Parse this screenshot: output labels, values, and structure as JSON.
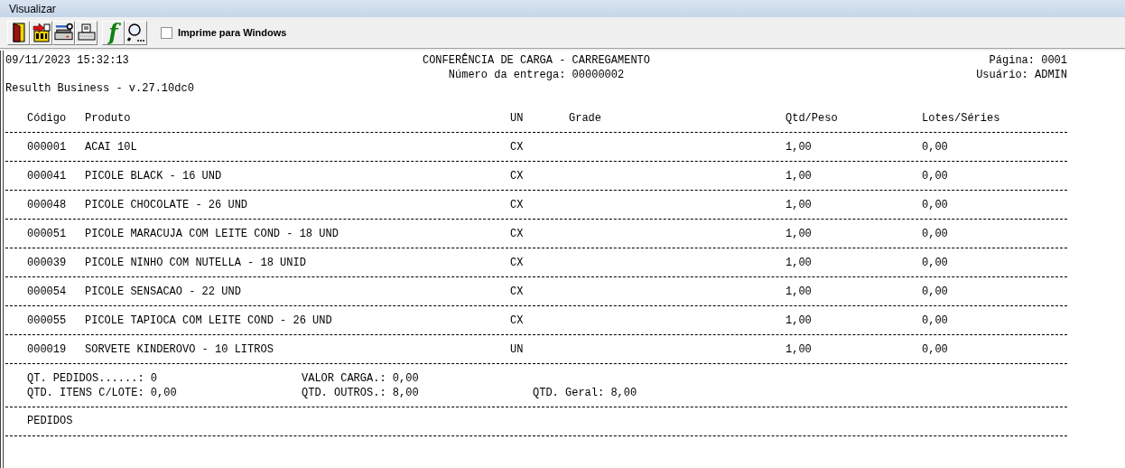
{
  "window": {
    "title": "Visualizar"
  },
  "toolbar": {
    "buttons": [
      {
        "kind": "exit"
      },
      {
        "kind": "export"
      },
      {
        "kind": "printer_setup"
      },
      {
        "kind": "print"
      },
      {
        "kind": "function",
        "label": "f"
      },
      {
        "kind": "zoom"
      }
    ],
    "print_windows": {
      "label": "Imprime para Windows",
      "checked": false
    }
  },
  "report": {
    "datetime": "09/11/2023 15:32:13",
    "title": "CONFERÊNCIA DE CARGA - CARREGAMENTO",
    "delivery": "Número da entrega: 00000002",
    "page": "Página: 0001",
    "user": "Usuário: ADMIN",
    "system": "Resulth Business - v.27.10dc0",
    "columns": [
      "Código",
      "Produto",
      "UN",
      "Grade",
      "Qtd/Peso",
      "Lotes/Séries"
    ],
    "rows": [
      [
        "000001",
        "ACAI 10L",
        "CX",
        "",
        "1,00",
        "0,00"
      ],
      [
        "000041",
        "PICOLE BLACK - 16 UND",
        "CX",
        "",
        "1,00",
        "0,00"
      ],
      [
        "000048",
        "PICOLE CHOCOLATE - 26 UND",
        "CX",
        "",
        "1,00",
        "0,00"
      ],
      [
        "000051",
        "PICOLE MARACUJA COM LEITE COND - 18 UND",
        "CX",
        "",
        "1,00",
        "0,00"
      ],
      [
        "000039",
        "PICOLE NINHO COM NUTELLA - 18 UNID",
        "CX",
        "",
        "1,00",
        "0,00"
      ],
      [
        "000054",
        "PICOLE SENSACAO - 22 UND",
        "CX",
        "",
        "1,00",
        "0,00"
      ],
      [
        "000055",
        "PICOLE TAPIOCA COM LEITE COND - 26 UND",
        "CX",
        "",
        "1,00",
        "0,00"
      ],
      [
        "000019",
        "SORVETE KINDEROVO - 10 LITROS",
        "UN",
        "",
        "1,00",
        "0,00"
      ]
    ],
    "totals": [
      [
        "QT. PEDIDOS......: 0",
        "VALOR CARGA.: 0,00"
      ],
      [
        "QTD. ITENS C/LOTE: 0,00",
        "QTD. OUTROS.: 8,00",
        "QTD. Geral: 8,00"
      ]
    ],
    "section": "PEDIDOS"
  }
}
